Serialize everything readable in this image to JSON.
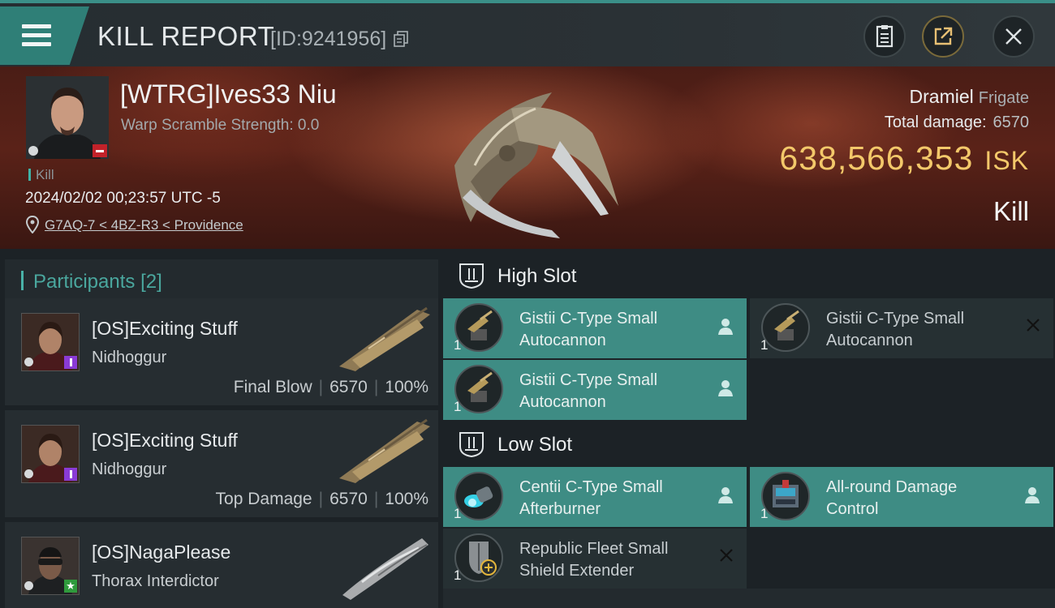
{
  "header": {
    "title": "KILL REPORT",
    "report_id": "[ID:9241956]"
  },
  "victim": {
    "name": "[WTRG]Ives33 Niu",
    "warp_scramble": "Warp Scramble Strength: 0.0",
    "kill_tag": "Kill",
    "datetime": "2024/02/02 00;23:57 UTC -5",
    "location": "G7AQ-7 < 4BZ-R3 < Providence",
    "ship": "Dramiel",
    "ship_class": "Frigate",
    "total_damage_label": "Total damage:",
    "total_damage": "6570",
    "isk_value": "638,566,353",
    "isk_unit": "ISK",
    "result": "Kill"
  },
  "participants": {
    "label": "Participants",
    "count": "[2]",
    "items": [
      {
        "name": "[OS]Exciting Stuff",
        "ship": "Nidhoggur",
        "role": "Final Blow",
        "damage": "6570",
        "percent": "100%"
      },
      {
        "name": "[OS]Exciting Stuff",
        "ship": "Nidhoggur",
        "role": "Top Damage",
        "damage": "6570",
        "percent": "100%"
      },
      {
        "name": "[OS]NagaPlease",
        "ship": "Thorax Interdictor"
      }
    ]
  },
  "fitting": {
    "high_slot_label": "High Slot",
    "low_slot_label": "Low Slot",
    "high": [
      {
        "name": "Gistii C-Type Small Autocannon",
        "qty": "1",
        "state": "fitted"
      },
      {
        "name": "Gistii C-Type Small Autocannon",
        "qty": "1",
        "state": "destroyed"
      },
      {
        "name": "Gistii C-Type Small Autocannon",
        "qty": "1",
        "state": "fitted"
      }
    ],
    "low": [
      {
        "name": "Centii C-Type Small Afterburner",
        "qty": "1",
        "state": "fitted"
      },
      {
        "name": "All-round Damage Control",
        "qty": "1",
        "state": "fitted"
      },
      {
        "name": "Republic Fleet Small Shield Extender",
        "qty": "1",
        "state": "destroyed"
      }
    ]
  },
  "icons": [
    "menu-icon",
    "copy-icon",
    "document-icon",
    "share-icon",
    "close-icon",
    "location-pin-icon",
    "slot-icon",
    "pilot-icon",
    "destroyed-x-icon"
  ],
  "colors": {
    "accent": "#3e8c84",
    "isk": "#f3c86a",
    "banner": "#5a2218"
  }
}
